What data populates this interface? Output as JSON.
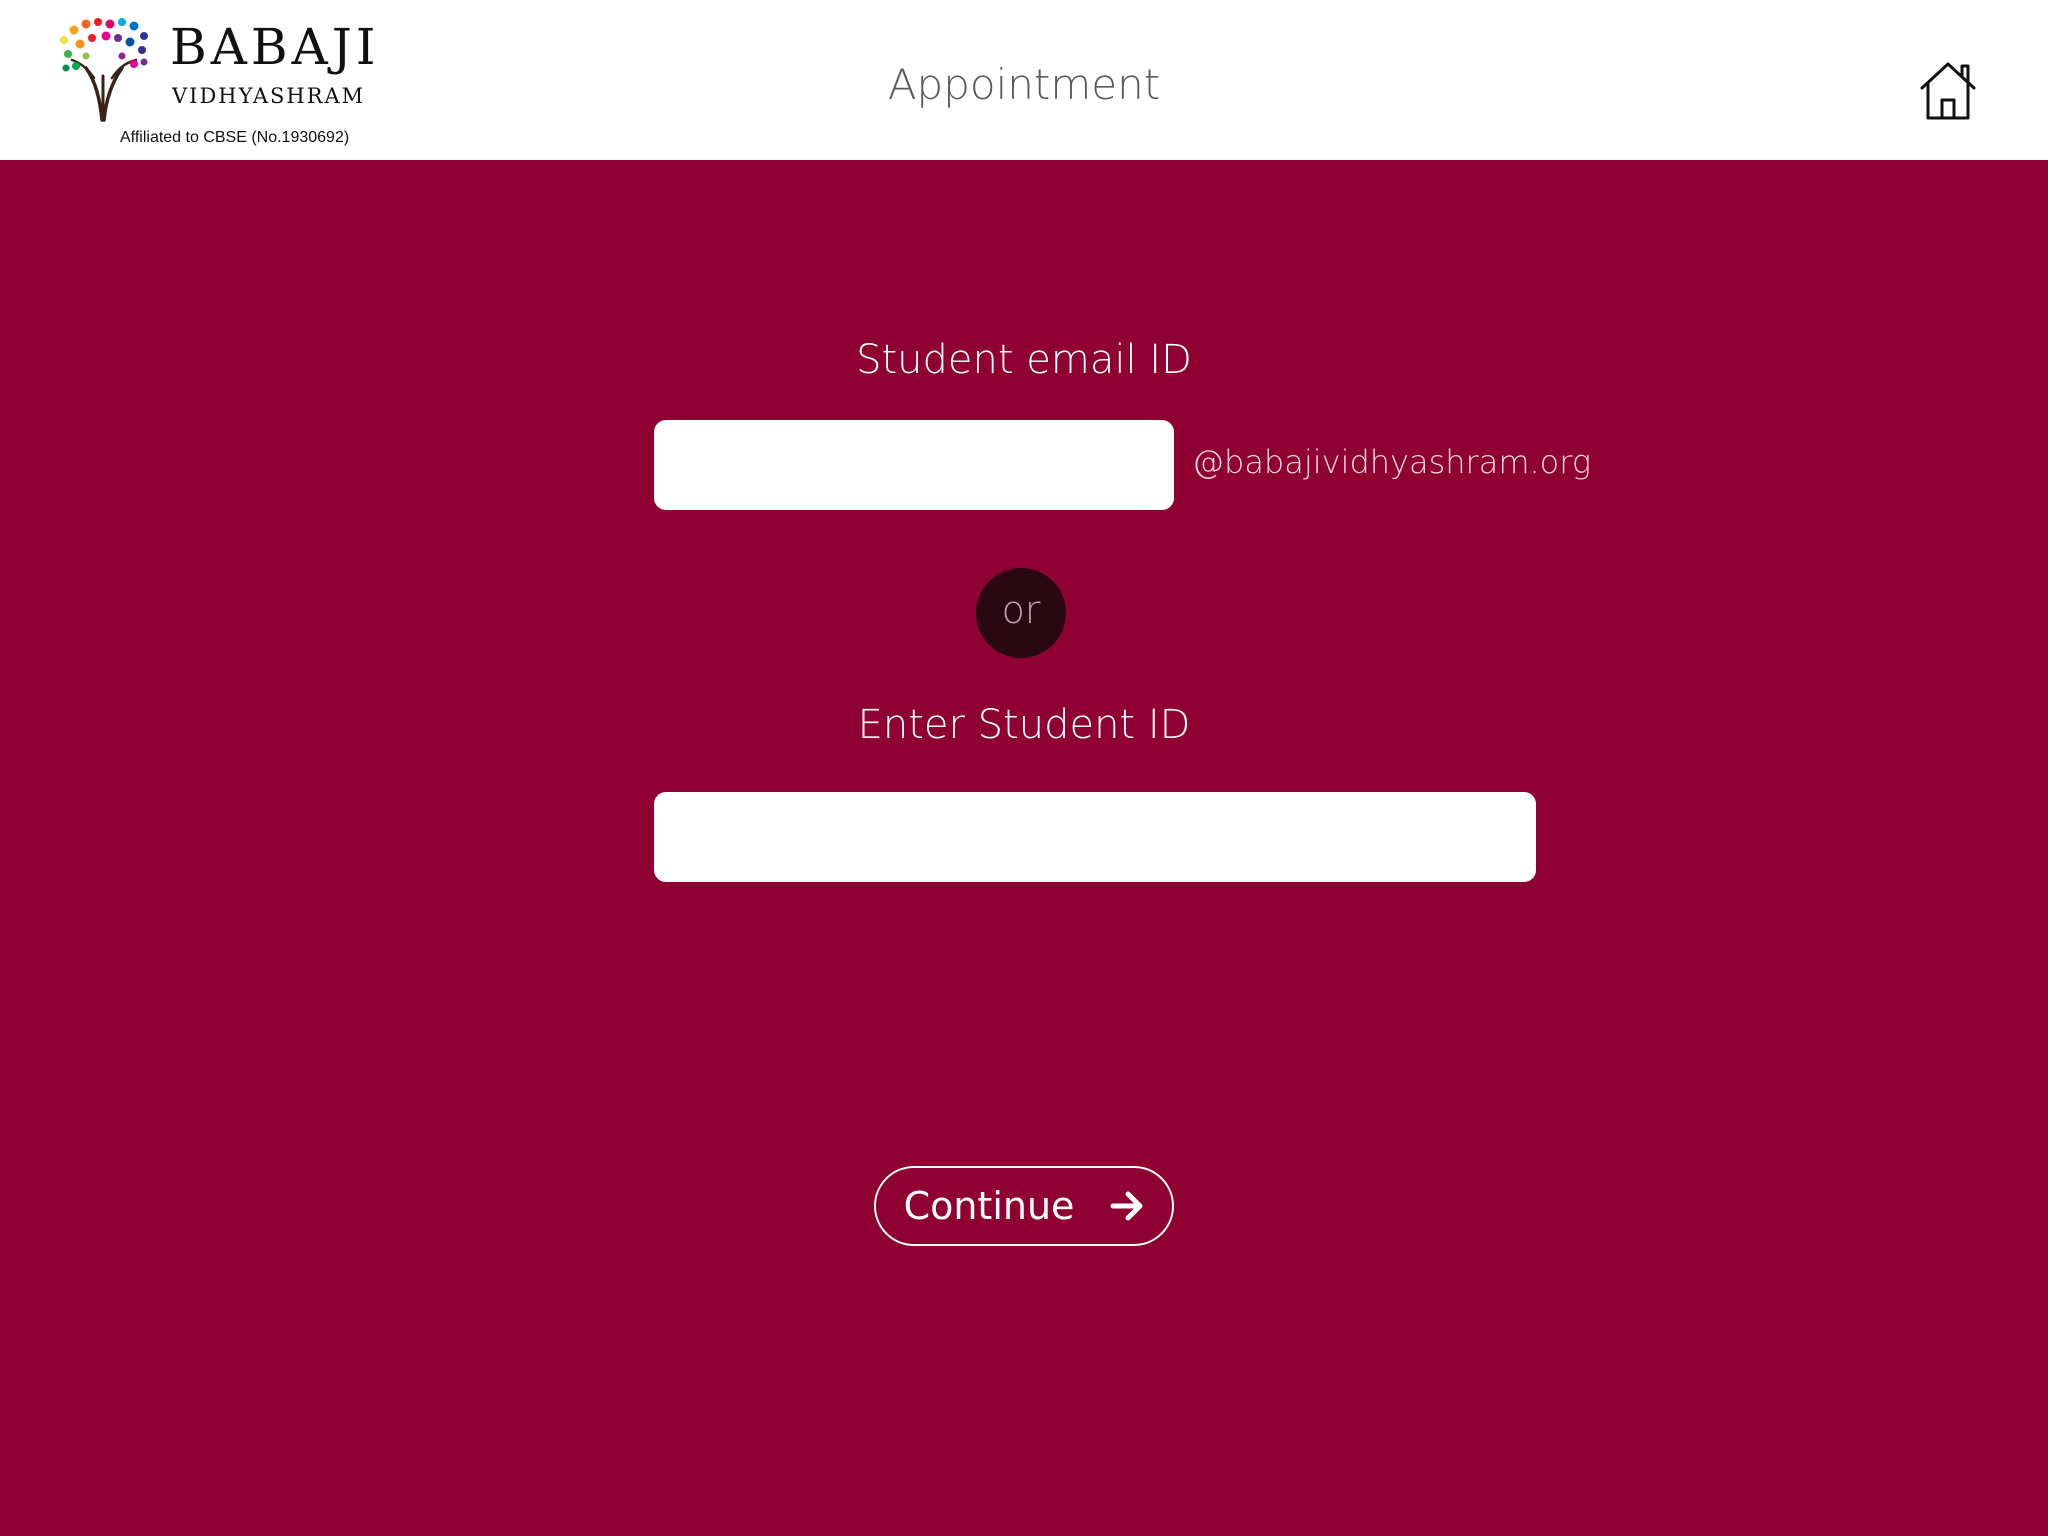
{
  "header": {
    "logo": {
      "title": "BABAJI",
      "subtitle": "VIDHYASHRAM",
      "affiliation": "Affiliated to CBSE (No.1930692)"
    },
    "title": "Appointment",
    "home_icon": "home-icon"
  },
  "form": {
    "email_label": "Student email ID",
    "email_value": "",
    "email_domain": "@babajividhyashram.org",
    "or_text": "or",
    "student_id_label": "Enter Student ID",
    "student_id_value": "",
    "continue_label": "Continue",
    "continue_icon": "arrow-right-icon"
  },
  "colors": {
    "primary": "#8f0033",
    "header_background": "#ffffff",
    "or_circle": "#2a0811"
  }
}
